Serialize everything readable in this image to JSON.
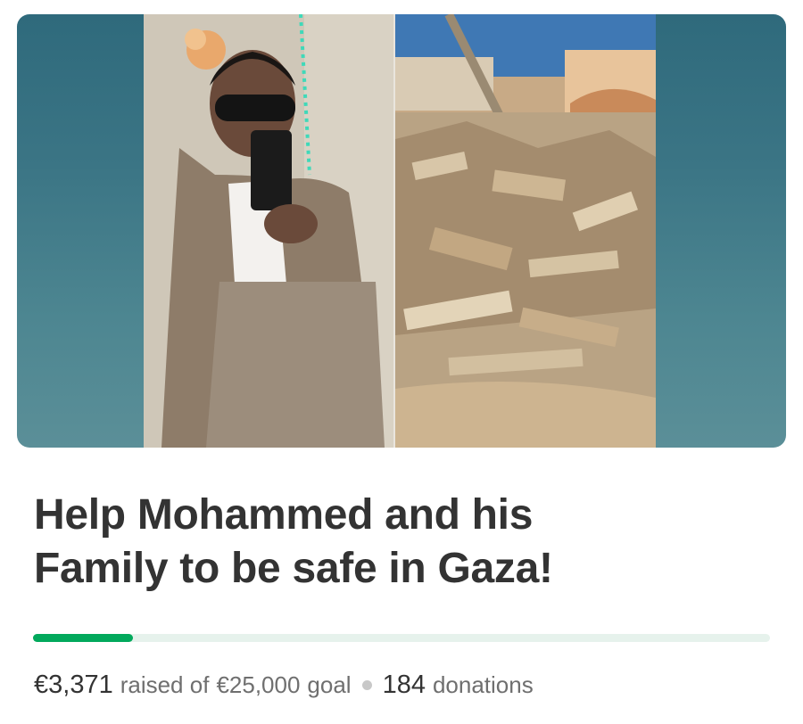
{
  "campaign": {
    "title_line1": "Help Mohammed and his",
    "title_line2": "Family to be safe in Gaza!",
    "raised": "€3,371",
    "raised_of": "raised of",
    "goal": "€25,000",
    "goal_suffix": "goal",
    "donations_count": "184",
    "donations_label": "donations",
    "progress": 0.135,
    "accent_color": "#02a95c"
  }
}
